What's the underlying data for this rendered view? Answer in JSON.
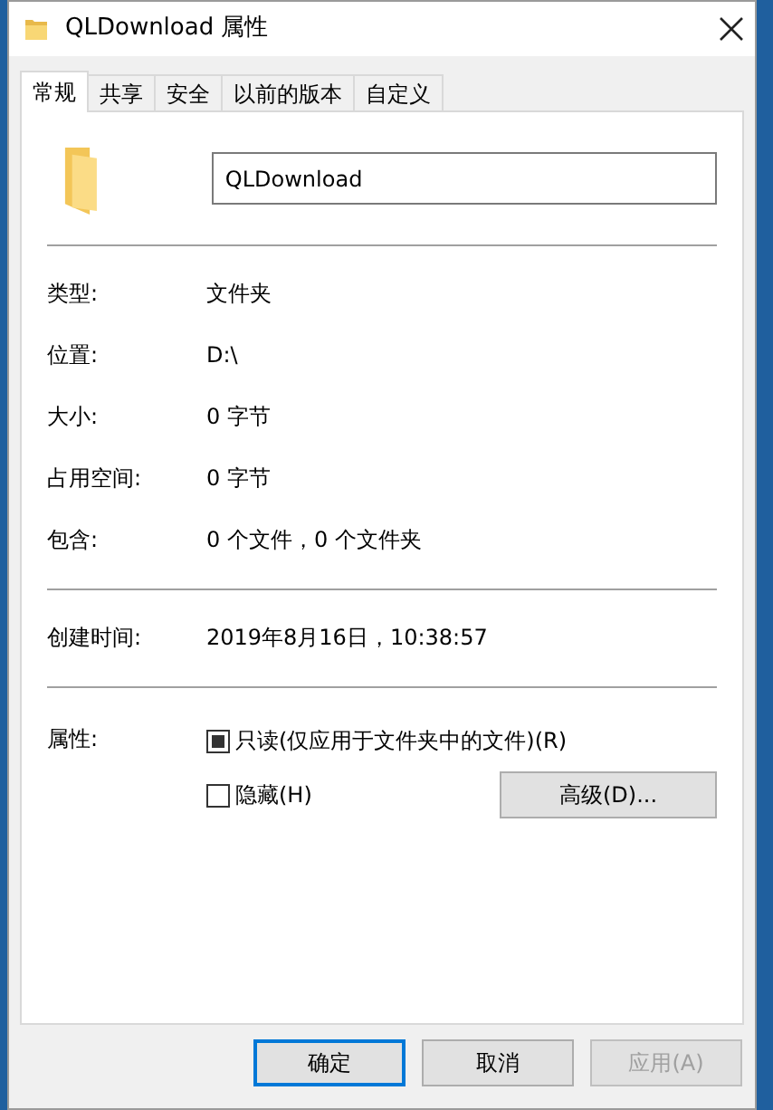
{
  "window": {
    "title": "QLDownload 属性"
  },
  "tabs": [
    {
      "label": "常规",
      "selected": true
    },
    {
      "label": "共享",
      "selected": false
    },
    {
      "label": "安全",
      "selected": false
    },
    {
      "label": "以前的版本",
      "selected": false
    },
    {
      "label": "自定义",
      "selected": false
    }
  ],
  "name_field": {
    "value": "QLDownload"
  },
  "groups": [
    [
      {
        "label": "类型:",
        "value": "文件夹"
      },
      {
        "label": "位置:",
        "value": "D:\\"
      },
      {
        "label": "大小:",
        "value": "0 字节"
      },
      {
        "label": "占用空间:",
        "value": "0 字节"
      },
      {
        "label": "包含:",
        "value": "0 个文件，0 个文件夹"
      }
    ],
    [
      {
        "label": "创建时间:",
        "value": "2019年8月16日，10:38:57"
      }
    ]
  ],
  "attributes": {
    "label": "属性:",
    "checkboxes": [
      {
        "label": "只读(仅应用于文件夹中的文件)(R)",
        "indeterminate": true
      },
      {
        "label": "隐藏(H)",
        "indeterminate": false
      }
    ],
    "advanced_button": "高级(D)..."
  },
  "buttons": [
    {
      "label": "确定",
      "default": true,
      "disabled": false
    },
    {
      "label": "取消",
      "default": false,
      "disabled": false
    },
    {
      "label": "应用(A)",
      "default": false,
      "disabled": true
    }
  ]
}
